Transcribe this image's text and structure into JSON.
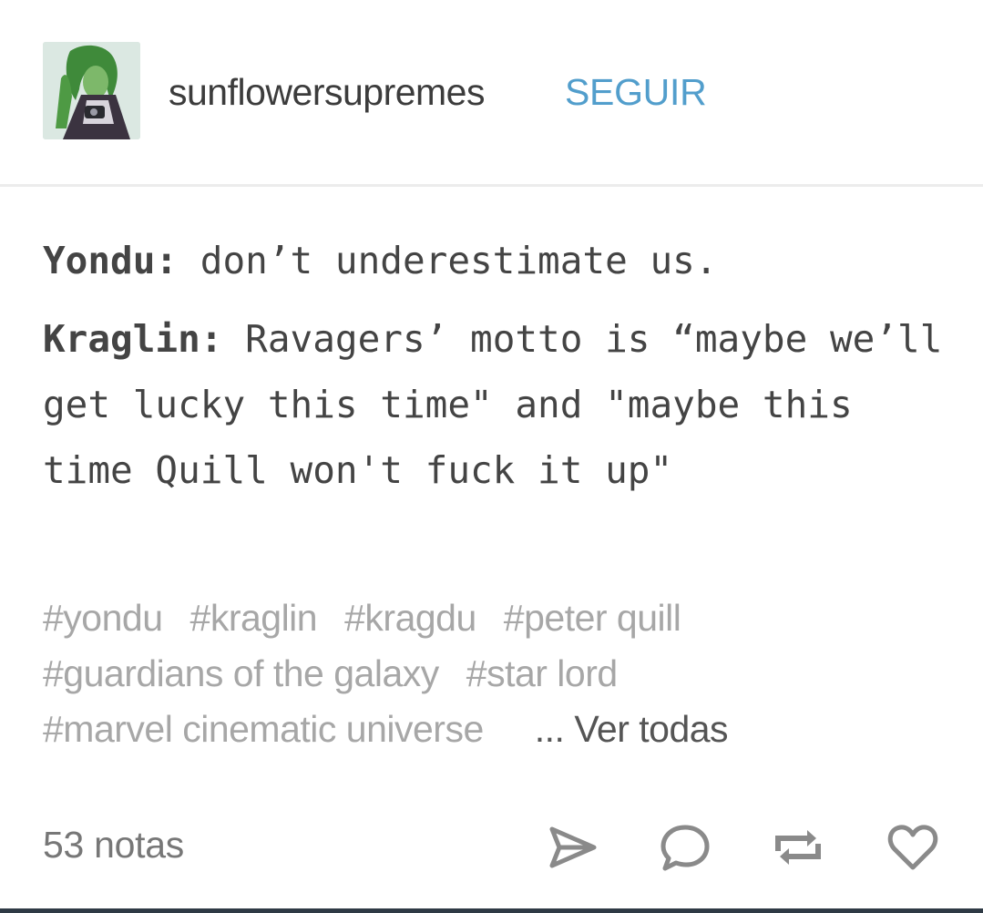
{
  "header": {
    "username": "sunflowersupremes",
    "follow_label": "SEGUIR",
    "avatar_icon": "avatar-green-haired-character-icon"
  },
  "post": {
    "line1": {
      "speaker": "Yondu:",
      "text": " don’t underestimate us."
    },
    "line2": {
      "speaker": "Kraglin:",
      "text": " Ravagers’ motto is “maybe we’ll get lucky this time\" and \"maybe this time Quill won't fuck it up\""
    }
  },
  "tags": {
    "items": [
      "#yondu",
      "#kraglin",
      "#kragdu",
      "#peter quill",
      "#guardians of the galaxy",
      "#star lord",
      "#marvel cinematic universe"
    ],
    "see_all_label": "... Ver todas"
  },
  "footer": {
    "notes_label": "53 notas",
    "icons": [
      "send-icon",
      "comment-icon",
      "reblog-icon",
      "heart-icon"
    ]
  },
  "colors": {
    "accent": "#529ecc",
    "text": "#444444",
    "tags": "#a7a7a7"
  }
}
